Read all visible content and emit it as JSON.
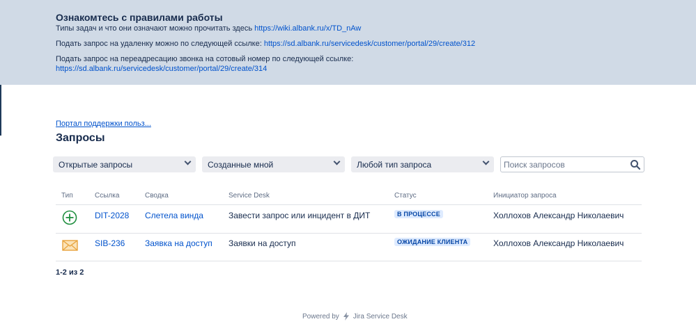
{
  "banner": {
    "title": "Ознакомтесь с правилами работы",
    "lines": [
      {
        "text": "Типы задач и что они означают можно прочитать здесь ",
        "link": "https://wiki.albank.ru/x/TD_nAw"
      },
      {
        "text": "Подать запрос на удаленку можно по следующей ссылке: ",
        "link": "https://sd.albank.ru/servicedesk/customer/portal/29/create/312"
      },
      {
        "text": "Подать запрос на переадресацию звонка на сотовый номер по следующей ссылке:",
        "link": "https://sd.albank.ru/servicedesk/customer/portal/29/create/314"
      }
    ]
  },
  "breadcrumb": "Портал поддержки польз...",
  "page_title": "Запросы",
  "filters": {
    "status": "Открытые запросы",
    "owner": "Созданные мной",
    "type": "Любой тип запроса",
    "search_placeholder": "Поиск запросов"
  },
  "table": {
    "headers": [
      "Тип",
      "Ссылка",
      "Сводка",
      "Service Desk",
      "Статус",
      "Инициатор запроса"
    ],
    "rows": [
      {
        "type_icon": "plus-circle-icon",
        "key": "DIT-2028",
        "summary": "Слетела винда",
        "desk": "Завести запрос или инцидент в ДИТ",
        "status": "В ПРОЦЕССЕ",
        "reporter": "Холлохов Александр Николаевич"
      },
      {
        "type_icon": "envelope-icon",
        "key": "SIB-236",
        "summary": "Заявка на доступ",
        "desk": "Заявки на доступ",
        "status": "ОЖИДАНИЕ КЛИЕНТА",
        "reporter": "Холлохов Александр Николаевич"
      }
    ]
  },
  "pager": "1-2 из 2",
  "footer": {
    "powered": "Powered by",
    "product": "Jira Service Desk"
  },
  "colors": {
    "banner_bg": "#d0dae6",
    "link": "#0052cc",
    "lozenge_bg": "#deebff",
    "lozenge_text": "#0747a6",
    "plus_icon": "#1e8e3e",
    "envelope_icon": "#e8a33d"
  }
}
